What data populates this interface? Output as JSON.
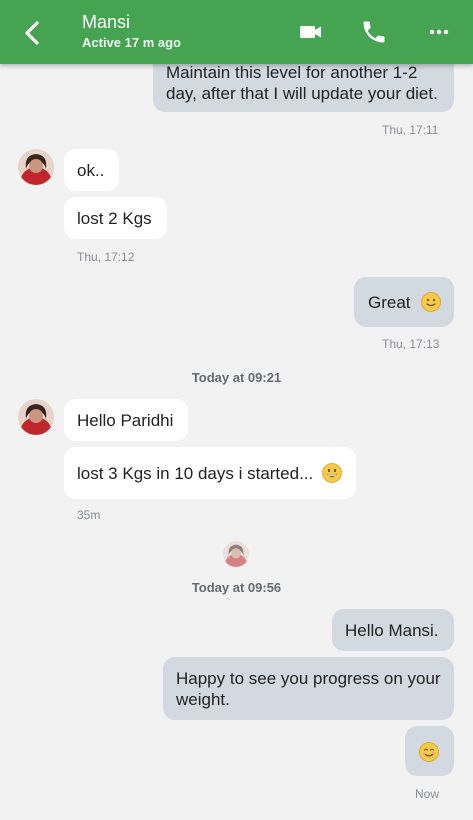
{
  "header": {
    "name": "Mansi",
    "status": "Active 17 m ago",
    "icons": [
      "back-arrow-icon",
      "video-call-icon",
      "phone-call-icon",
      "more-options-icon"
    ],
    "color": "#45a352"
  },
  "messages": {
    "m1": "Maintain this level for another 1-2 day, after that I will update your diet.",
    "t1": "Thu, 17:11",
    "m2": "ok..",
    "m3": "lost 2 Kgs",
    "t2": "Thu, 17:12",
    "m4": "Great",
    "t3": "Thu, 17:13",
    "sep1": "Today at 09:21",
    "m5": "Hello Paridhi",
    "m6": "lost 3 Kgs in 10 days i started...",
    "t4": "35m",
    "sep2": "Today at 09:56",
    "m7": "Hello Mansi.",
    "m8": "Happy to see you progress on your weight.",
    "t5": "Now"
  },
  "colors": {
    "outgoing_bubble": "#d3d9e0",
    "incoming_bubble": "#ffffff",
    "background": "#f2f2f2"
  }
}
